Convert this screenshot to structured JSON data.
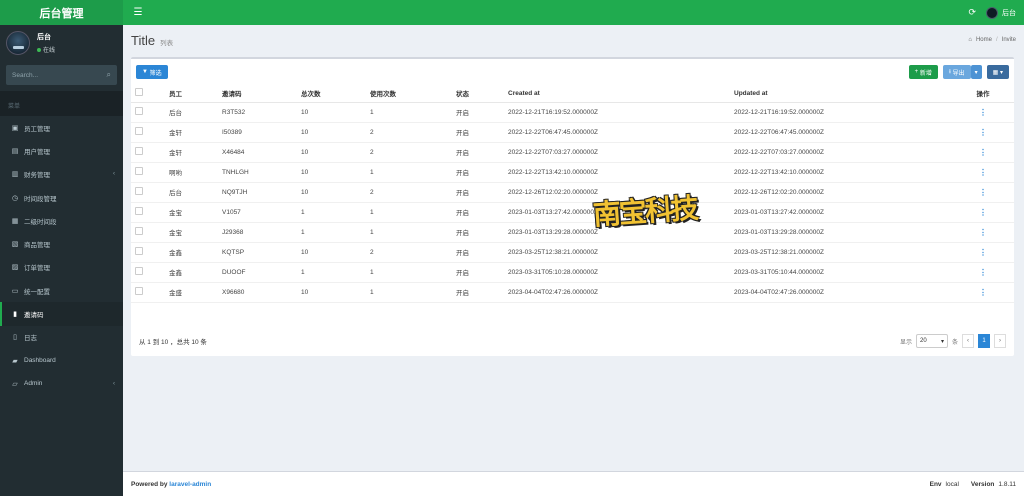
{
  "brand": "后台管理",
  "header": {
    "username": "后台"
  },
  "sidebar": {
    "user": {
      "name": "后台",
      "status": "在线"
    },
    "search_placeholder": "Search...",
    "section": "菜单",
    "items": [
      {
        "label": "员工管理",
        "icon": "user-icon",
        "active": false,
        "chevron": false
      },
      {
        "label": "用户管理",
        "icon": "users-icon",
        "active": false,
        "chevron": false
      },
      {
        "label": "财务管理",
        "icon": "money-icon",
        "active": false,
        "chevron": true
      },
      {
        "label": "时间段管理",
        "icon": "clock-icon",
        "active": false,
        "chevron": false
      },
      {
        "label": "二级时间段",
        "icon": "calendar-icon",
        "active": false,
        "chevron": false
      },
      {
        "label": "商品管理",
        "icon": "box-icon",
        "active": false,
        "chevron": false
      },
      {
        "label": "订单管理",
        "icon": "cart-icon",
        "active": false,
        "chevron": false
      },
      {
        "label": "统一配置",
        "icon": "settings-icon",
        "active": false,
        "chevron": false
      },
      {
        "label": "邀请码",
        "icon": "ticket-icon",
        "active": true,
        "chevron": false
      },
      {
        "label": "日志",
        "icon": "log-icon",
        "active": false,
        "chevron": false
      },
      {
        "label": "Dashboard",
        "icon": "dashboard-icon",
        "active": false,
        "chevron": false
      },
      {
        "label": "Admin",
        "icon": "admin-icon",
        "active": false,
        "chevron": true
      }
    ]
  },
  "page": {
    "title": "Title",
    "subtitle": "列表",
    "breadcrumb": [
      "Home",
      "Invite"
    ]
  },
  "toolbar": {
    "filter": "筛选",
    "new": "新增",
    "export": "导出"
  },
  "table": {
    "headers": [
      "员工",
      "邀请码",
      "总次数",
      "使用次数",
      "状态",
      "Created at",
      "Updated at",
      "操作"
    ],
    "rows": [
      [
        "后台",
        "R3T532",
        "10",
        "1",
        "开启",
        "2022-12-21T16:19:52.000000Z",
        "2022-12-21T16:19:52.000000Z"
      ],
      [
        "金轩",
        "I50389",
        "10",
        "2",
        "开启",
        "2022-12-22T06:47:45.000000Z",
        "2022-12-22T06:47:45.000000Z"
      ],
      [
        "金轩",
        "X46484",
        "10",
        "2",
        "开启",
        "2022-12-22T07:03:27.000000Z",
        "2022-12-22T07:03:27.000000Z"
      ],
      [
        "啊哟",
        "TNHLGH",
        "10",
        "1",
        "开启",
        "2022-12-22T13:42:10.000000Z",
        "2022-12-22T13:42:10.000000Z"
      ],
      [
        "后台",
        "NQ9TJH",
        "10",
        "2",
        "开启",
        "2022-12-26T12:02:20.000000Z",
        "2022-12-26T12:02:20.000000Z"
      ],
      [
        "金宝",
        "V1057",
        "1",
        "1",
        "开启",
        "2023-01-03T13:27:42.000000Z",
        "2023-01-03T13:27:42.000000Z"
      ],
      [
        "金宝",
        "J29368",
        "1",
        "1",
        "开启",
        "2023-01-03T13:29:28.000000Z",
        "2023-01-03T13:29:28.000000Z"
      ],
      [
        "金鑫",
        "KQTSP",
        "10",
        "2",
        "开启",
        "2023-03-25T12:38:21.000000Z",
        "2023-03-25T12:38:21.000000Z"
      ],
      [
        "金鑫",
        "DUOOF",
        "1",
        "1",
        "开启",
        "2023-03-31T05:10:28.000000Z",
        "2023-03-31T05:10:44.000000Z"
      ],
      [
        "金盛",
        "X96680",
        "10",
        "1",
        "开启",
        "2023-04-04T02:47:26.000000Z",
        "2023-04-04T02:47:26.000000Z"
      ]
    ]
  },
  "pagination": {
    "summary": "从 1 到 10 ，总共 10 条",
    "show_label": "显示",
    "per_page": "20",
    "per_page_suffix": "条",
    "prev": "‹",
    "current": "1",
    "next": "›"
  },
  "watermark": "南宝科技",
  "footer": {
    "powered_by": "Powered by",
    "link": "laravel-admin",
    "env_label": "Env",
    "env_value": "local",
    "version_label": "Version",
    "version_value": "1.8.11"
  }
}
